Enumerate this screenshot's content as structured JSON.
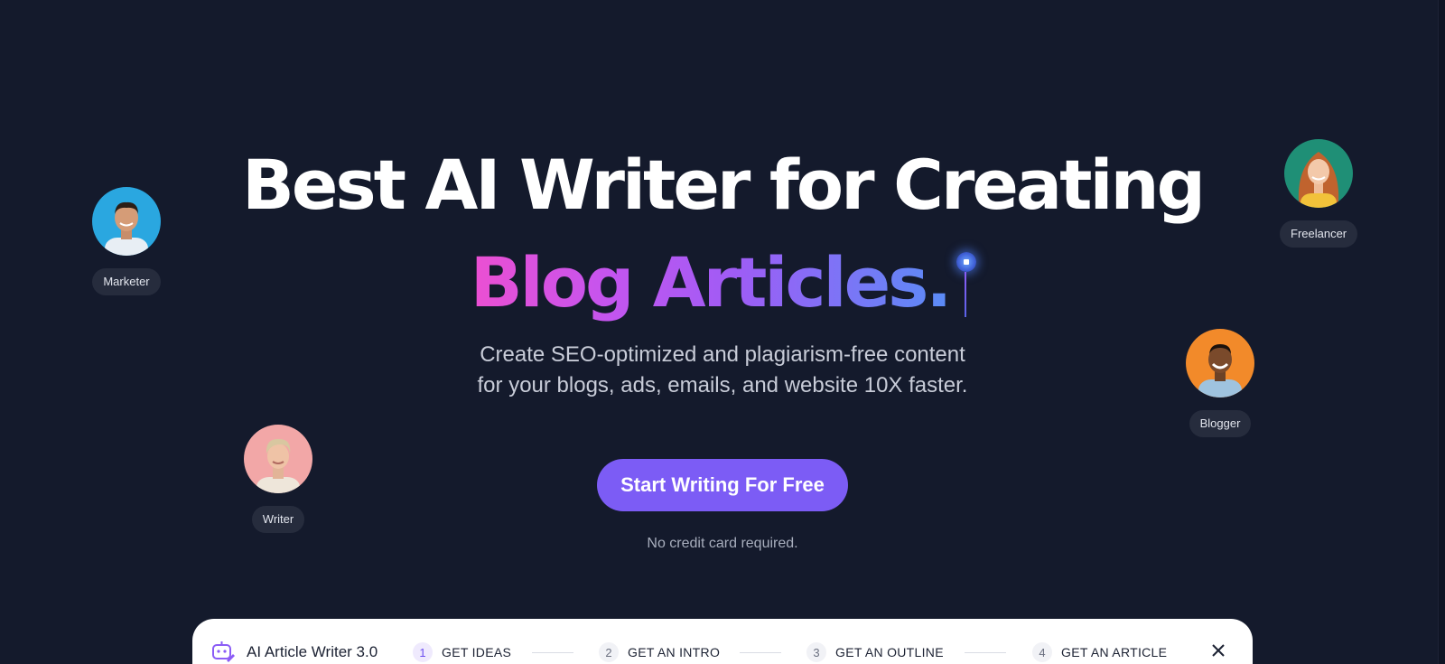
{
  "hero": {
    "headline_line1": "Best AI Writer for Creating",
    "headline_line2": "Blog Articles.",
    "subtitle_line1": "Create SEO-optimized and plagiarism-free content",
    "subtitle_line2": "for your blogs, ads, emails, and website 10X faster.",
    "cta_label": "Start Writing For Free",
    "note": "No credit card required."
  },
  "personas": [
    {
      "label": "Marketer",
      "avatar_bg": "#2aa7e0",
      "icon": "avatar-marketer"
    },
    {
      "label": "Writer",
      "avatar_bg": "#f2a7a7",
      "icon": "avatar-writer"
    },
    {
      "label": "Freelancer",
      "avatar_bg": "#1f8f76",
      "icon": "avatar-freelancer"
    },
    {
      "label": "Blogger",
      "avatar_bg": "#f28a2a",
      "icon": "avatar-blogger"
    }
  ],
  "steps_bar": {
    "app_title": "AI Article Writer 3.0",
    "steps": [
      {
        "num": "1",
        "label": "GET IDEAS"
      },
      {
        "num": "2",
        "label": "GET AN INTRO"
      },
      {
        "num": "3",
        "label": "GET AN OUTLINE"
      },
      {
        "num": "4",
        "label": "GET AN ARTICLE"
      }
    ]
  },
  "colors": {
    "background": "#141a2c",
    "accent": "#7c5cf5",
    "gradient_start": "#ec4fd2",
    "gradient_end": "#5a8cf7"
  }
}
